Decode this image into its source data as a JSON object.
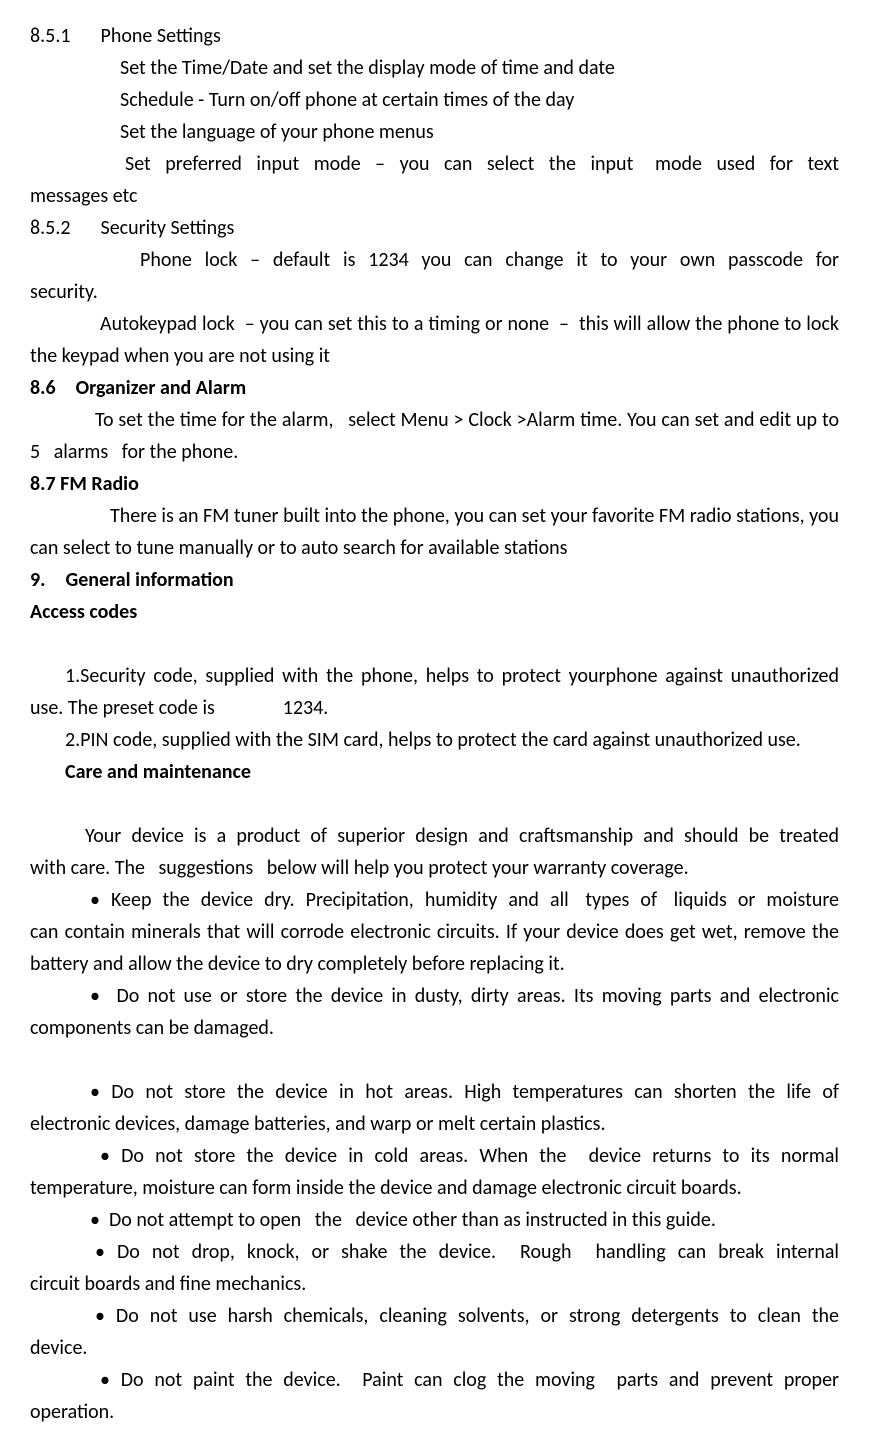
{
  "s851_header": "8.5.1  Phone Settings",
  "s851_line1": "Set the Time/Date and set the display mode of time and date",
  "s851_line2": "Schedule - Turn on/off phone at certain times of the day",
  "s851_line3": "Set the language of your phone menus",
  "s851_line4": "Set  preferred  input  mode  –  you  can  select  the  input   mode  used  for  text messages etc",
  "s852_header": "8.5.2  Security Settings",
  "s852_line1": "Phone  lock  –  default  is  1234  you  can  change  it  to  your  own  passcode  for security.",
  "s852_line2": "Autokeypad lock  – you can set this to a timing or none  –  this will allow the phone to lock the keypad when you are not using it",
  "s86_header": "8.6 Organizer and Alarm",
  "s86_body": "To set the time for the alarm,   select Menu > Clock >Alarm time. You can set and edit up to 5   alarms   for the phone.",
  "s87_header": "8.7 FM Radio",
  "s87_body": "There is an FM tuner built into the phone, you can set your favorite FM radio stations, you can select to tune manually or to auto search for available stations",
  "s9_header": "9. General information",
  "s9_access_codes": "Access codes",
  "s9_code1": "1.Security code, supplied with the phone, helps to protect yourphone against unauthorized use. The preset code is               1234.",
  "s9_code2": "2.PIN code, supplied with the SIM card, helps to protect the card against unauthorized use.",
  "s9_care_header": "Care and maintenance",
  "s9_care_intro": "Your  device  is  a  product  of  superior  design  and  craftsmanship  and  should  be  treated with care. The   suggestions   below will help you protect your warranty coverage.",
  "bullet1": "•  Keep  the  device  dry.  Precipitation,  humidity  and  all   types  of   liquids  or  moisture can contain minerals that will corrode electronic circuits. If your device does get wet, remove the battery and allow the device to dry completely before replacing it.",
  "bullet2": "•  Do not use or store the device in dusty, dirty areas. Its moving parts and electronic components can be damaged.",
  "bullet3": "•  Do  not  store  the  device  in  hot  areas.  High  temperatures  can  shorten  the  life  of electronic devices, damage batteries, and warp or melt certain plastics.",
  "bullet4": "•  Do  not  store  the  device  in  cold  areas.  When  the    device  returns  to  its  normal temperature, moisture can form inside the device and damage electronic circuit boards.",
  "bullet5": "•  Do not attempt to open   the   device other than as instructed in this guide.",
  "bullet6": "•  Do  not  drop,  knock,  or  shake  the  device.    Rough    handling  can  break  internal circuit boards and fine mechanics.",
  "bullet7": "•  Do  not  use  harsh  chemicals,  cleaning  solvents,  or  strong  detergents  to  clean  the device.",
  "bullet8": "•  Do  not  paint  the  device.    Paint  can  clog  the  moving    parts  and  prevent  proper operation."
}
